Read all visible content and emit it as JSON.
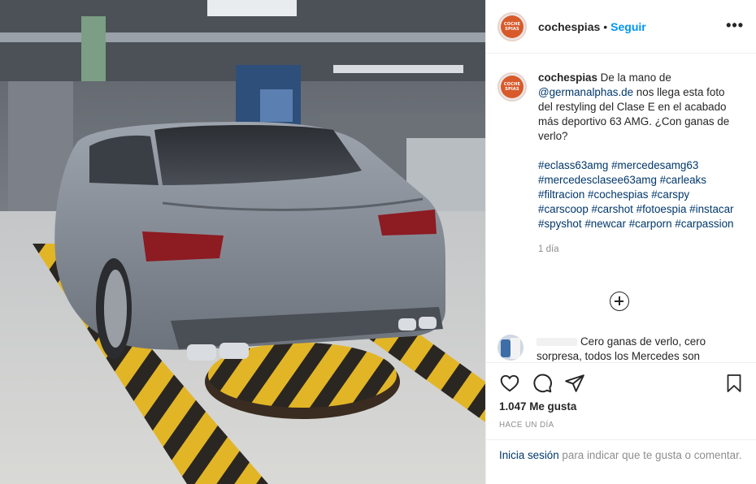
{
  "post": {
    "username": "cochespias",
    "separator": "•",
    "follow_label": "Seguir",
    "more_label": "•••",
    "avatar_text": "COCHE SPIAS"
  },
  "caption": {
    "username": "cochespias",
    "text_before_link": " De la mano de ",
    "mention": "@germanalphas.de",
    "text_after_link": " nos llega esta foto del restyling del Clase E en el acabado más deportivo 63 AMG. ¿Con ganas de verlo?",
    "hashtags": [
      "#eclass63amg",
      "#mercedesamg63",
      "#mercedesclasee63amg",
      "#carleaks",
      "#filtracion",
      "#cochespias",
      "#carspy",
      "#carscoop",
      "#carshot",
      "#fotoespia",
      "#instacar",
      "#spyshot",
      "#newcar",
      "#carporn",
      "#carpassion"
    ],
    "time": "1 día"
  },
  "comment": {
    "text": "Cero ganas de verlo, cero sorpresa, todos los Mercedes son"
  },
  "actions": {
    "like_icon": "heart-icon",
    "comment_icon": "comment-icon",
    "share_icon": "paper-plane-icon",
    "save_icon": "bookmark-icon",
    "likes_text": "1.047 Me gusta",
    "post_time": "HACE UN DÍA"
  },
  "login": {
    "link_label": "Inicia sesión",
    "rest_text": " para indicar que te gusta o comentar."
  },
  "colors": {
    "accent_blue": "#0095f6",
    "link_blue": "#00376b",
    "muted": "#8e8e8e",
    "brand_avatar": "#d85a2b"
  }
}
